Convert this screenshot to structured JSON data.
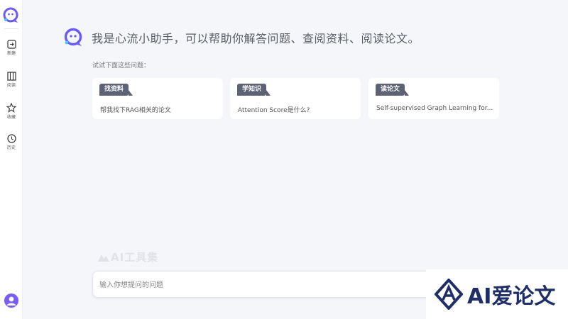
{
  "sidebar": {
    "items": [
      {
        "label": "新建",
        "icon": "new-chat-icon"
      },
      {
        "label": "阅读",
        "icon": "book-icon"
      },
      {
        "label": "收藏",
        "icon": "collection-icon"
      },
      {
        "label": "历史",
        "icon": "history-icon"
      }
    ]
  },
  "hero": {
    "title": "我是心流小助手，可以帮助你解答问题、查阅资料、阅读论文。"
  },
  "suggestions": {
    "hint": "试试下面这些问题：",
    "cards": [
      {
        "tag": "找资料",
        "question": "帮我找下RAG相关的论文"
      },
      {
        "tag": "学知识",
        "question": "Attention Score是什么?"
      },
      {
        "tag": "读论文",
        "question": "Self-supervised Graph Learning for..."
      }
    ]
  },
  "watermark": {
    "small_text": "AI工具集",
    "brand_text": "AI爱论文"
  },
  "input": {
    "placeholder": "输入你想提问的问题",
    "value": ""
  },
  "colors": {
    "accent": "#6a5af9",
    "tag_bg": "#5d6274",
    "brand_navy": "#1f2e66"
  }
}
